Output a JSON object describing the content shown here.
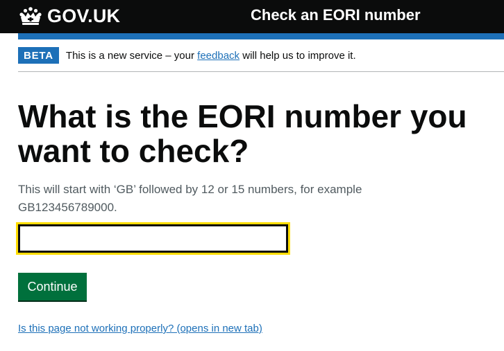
{
  "header": {
    "logo_text": "GOV.UK",
    "service_name": "Check an EORI number"
  },
  "phase_banner": {
    "tag": "BETA",
    "text_before": "This is a new service – your ",
    "link_text": "feedback",
    "text_after": " will help us to improve it."
  },
  "main": {
    "heading": "What is the EORI number you want to check?",
    "hint": "This will start with ‘GB’ followed by 12 or 15 numbers, for example GB123456789000.",
    "input_value": "",
    "continue_label": "Continue",
    "help_link": "Is this page not working properly? (opens in new tab)"
  },
  "colors": {
    "header_bg": "#0b0c0c",
    "brand_blue": "#1d70b8",
    "button_green": "#00703c",
    "focus_yellow": "#ffdd00",
    "hint_grey": "#505a5f"
  },
  "icons": {
    "logo": "crown-icon"
  }
}
